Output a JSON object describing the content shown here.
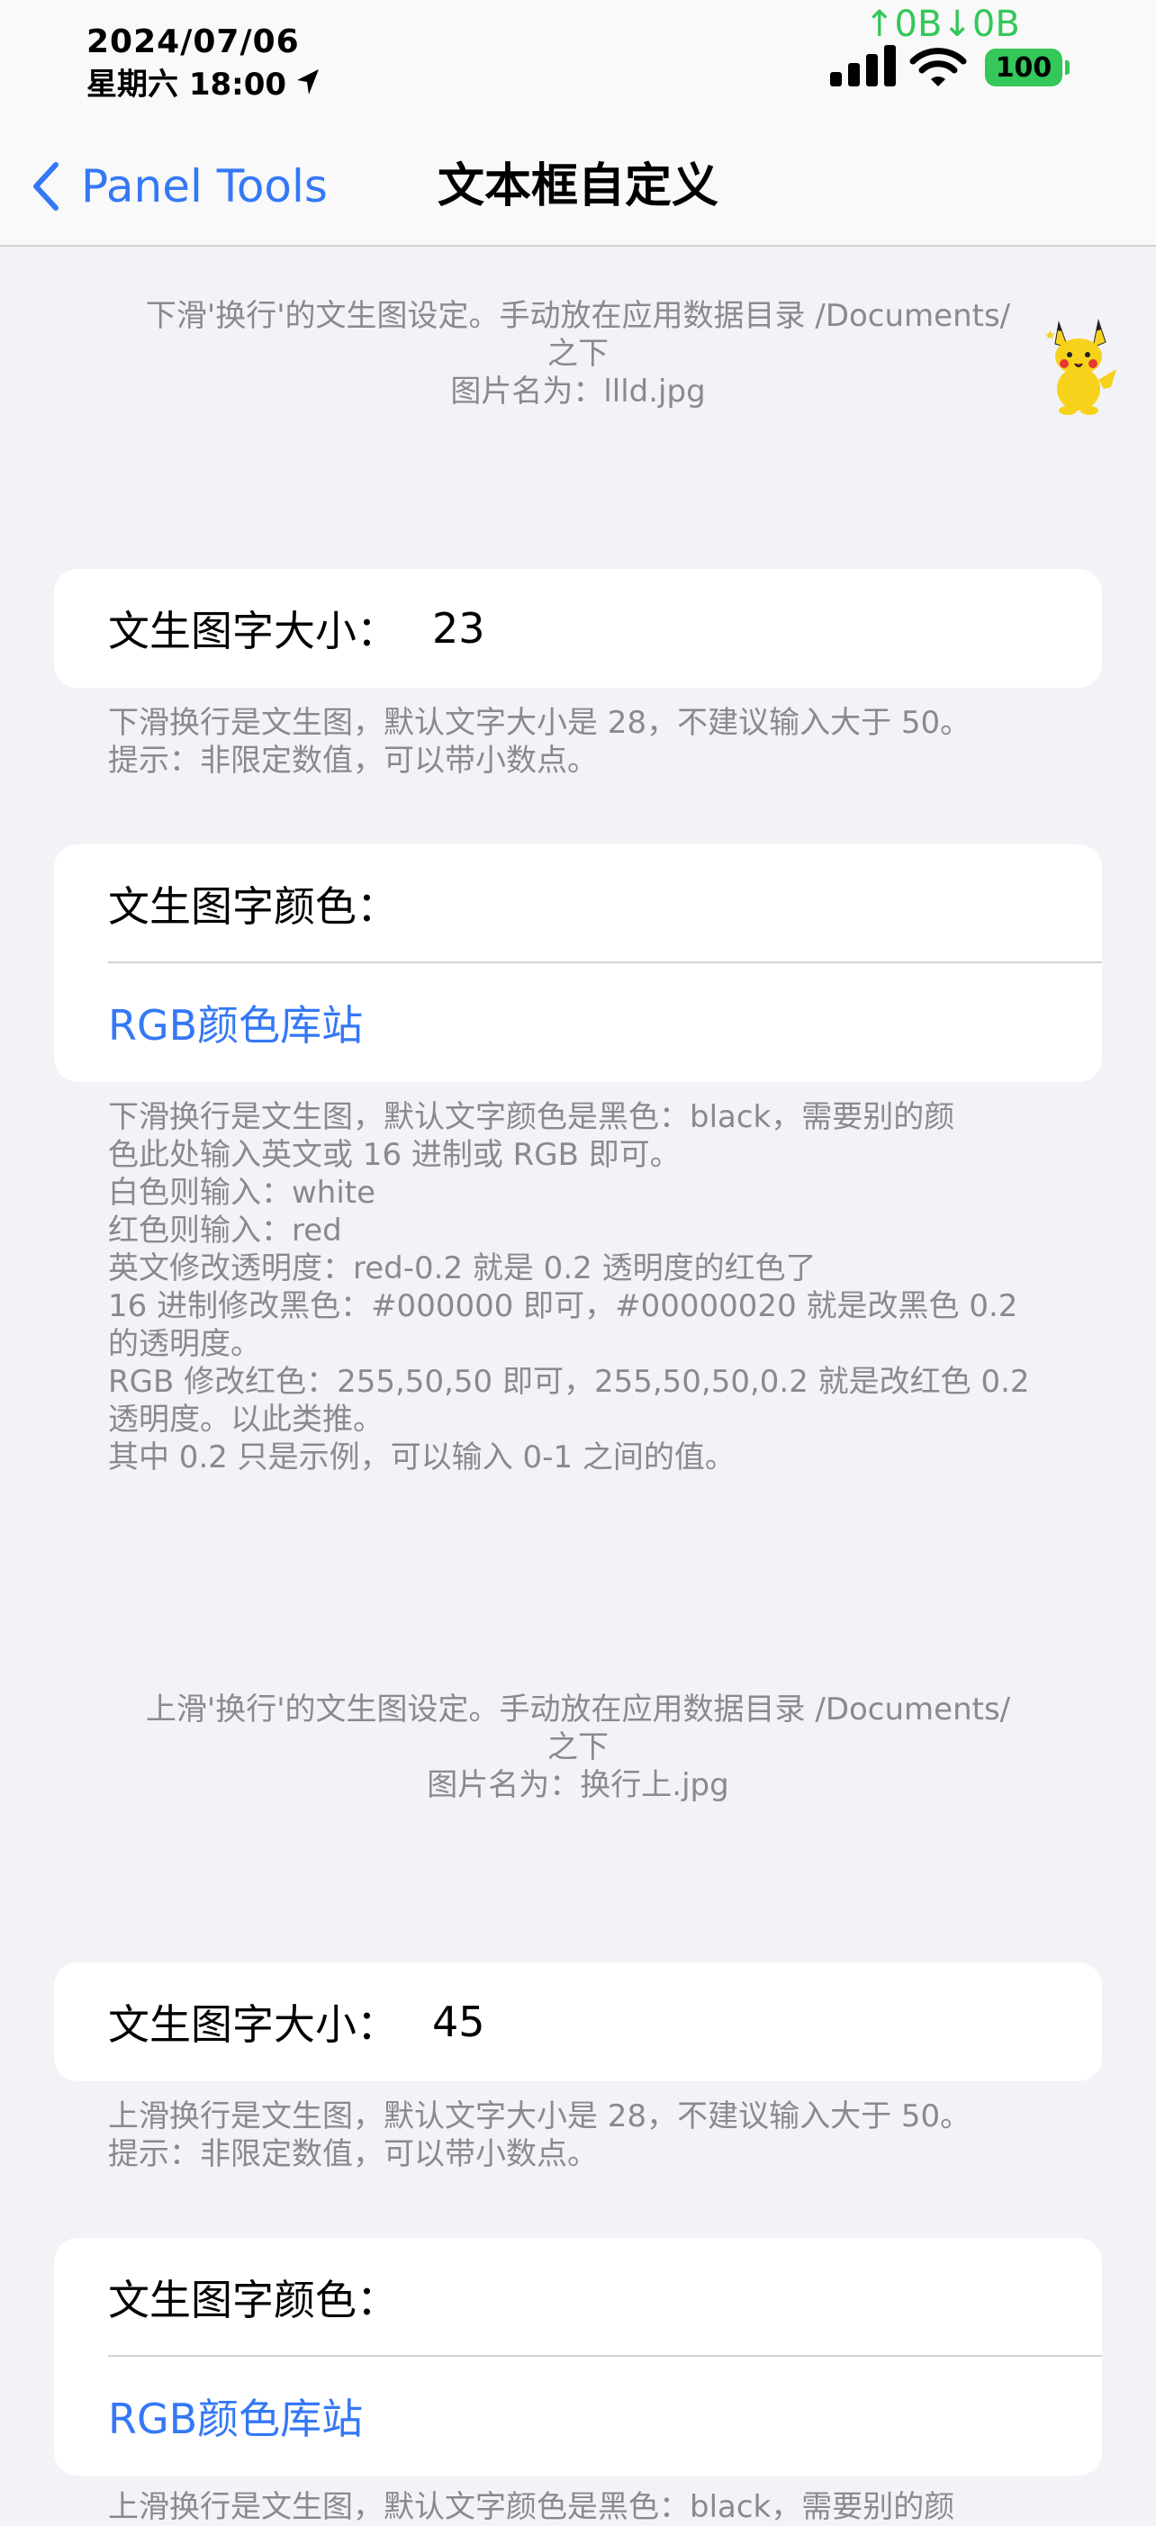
{
  "status_bar": {
    "date": "2024/07/06",
    "time": "星期六 18:00",
    "net_speed": "↑0B↓0B",
    "battery": "100"
  },
  "nav": {
    "back_label": "Panel Tools",
    "title": "文本框自定义"
  },
  "section1": {
    "info_line1": "下滑'换行'的文生图设定。手动放在应用数据目录 /Documents/",
    "info_line2": "之下",
    "info_line3": "图片名为：llld.jpg",
    "size_label": "文生图字大小：",
    "size_value": "23",
    "size_footer": [
      "下滑换行是文生图，默认文字大小是 28，不建议输入大于 50。",
      "提示：非限定数值，可以带小数点。"
    ],
    "color_label": "文生图字颜色：",
    "color_link": "RGB颜色库站",
    "color_footer": [
      "下滑换行是文生图，默认文字颜色是黑色：black，需要别的颜",
      "色此处输入英文或 16 进制或 RGB 即可。",
      "白色则输入：white",
      "红色则输入：red",
      "英文修改透明度：red-0.2 就是 0.2 透明度的红色了",
      "16 进制修改黑色：#000000 即可，#00000020 就是改黑色 0.2",
      "的透明度。",
      "RGB 修改红色：255,50,50 即可，255,50,50,0.2 就是改红色 0.2",
      "透明度。以此类推。",
      "其中 0.2 只是示例，可以输入 0-1 之间的值。"
    ]
  },
  "section2": {
    "info_line1": "上滑'换行'的文生图设定。手动放在应用数据目录 /Documents/",
    "info_line2": "之下",
    "info_line3": "图片名为：换行上.jpg",
    "size_label": "文生图字大小：",
    "size_value": "45",
    "size_footer": [
      "上滑换行是文生图，默认文字大小是 28，不建议输入大于 50。",
      "提示：非限定数值，可以带小数点。"
    ],
    "color_label": "文生图字颜色：",
    "color_link": "RGB颜色库站",
    "color_footer_partial": "上滑换行是文生图，默认文字颜色是黑色：black，需要别的颜"
  },
  "colors": {
    "accent": "#3478f6",
    "net_speed": "#34c759",
    "battery": "#34c759",
    "background": "#f2f2f7",
    "secondary_text": "#8a8a8e"
  }
}
